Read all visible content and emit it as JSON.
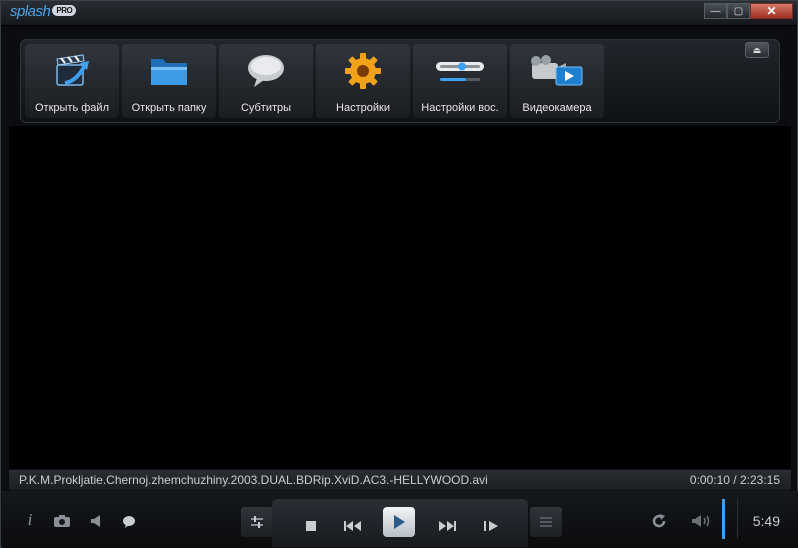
{
  "app": {
    "logo_text": "splash",
    "logo_badge": "PRO"
  },
  "window_controls": {
    "minimize": "—",
    "maximize": "▢",
    "close": "✕"
  },
  "toolbar": {
    "items": [
      {
        "label": "Открыть файл",
        "icon": "clapperboard-arrow-icon"
      },
      {
        "label": "Открыть папку",
        "icon": "folder-icon"
      },
      {
        "label": "Субтитры",
        "icon": "speech-bubble-icon"
      },
      {
        "label": "Настройки",
        "icon": "gear-icon"
      },
      {
        "label": "Настройки вос.",
        "icon": "sliders-icon"
      },
      {
        "label": "Видеокамера",
        "icon": "video-camera-icon"
      }
    ],
    "collapse_glyph": "⏏"
  },
  "status": {
    "filename": "P.K.M.Prokljatie.Chernoj.zhemchuzhiny.2003.DUAL.BDRip.XviD.AC3.-HELLYWOOD.avi",
    "time": "0:00:10 / 2:23:15"
  },
  "controls": {
    "clock": "5:49",
    "volume_level": 1.0
  },
  "colors": {
    "accent": "#3da0f0",
    "gear": "#f2a21a"
  }
}
